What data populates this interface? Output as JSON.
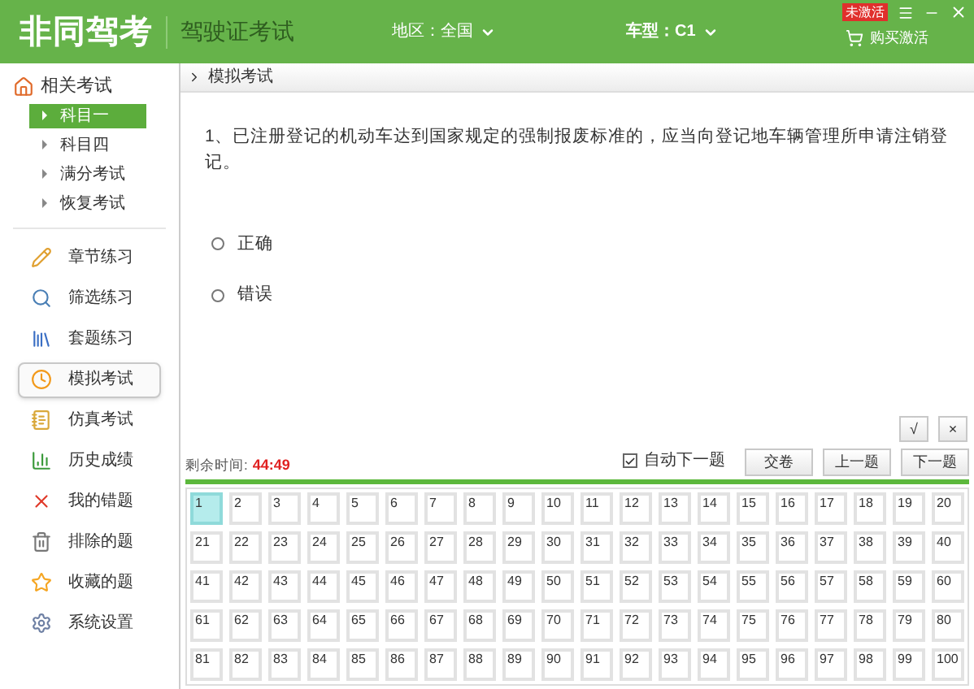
{
  "header": {
    "logo": "非同驾考",
    "subtitle": "驾驶证考试",
    "region": "地区：全国",
    "car_type": "车型：C1",
    "buy": "购买激活",
    "badge": "未激活"
  },
  "sidebar": {
    "section": "相关考试",
    "subjects": [
      {
        "label": "科目一",
        "selected": true
      },
      {
        "label": "科目四",
        "selected": false
      },
      {
        "label": "满分考试",
        "selected": false
      },
      {
        "label": "恢复考试",
        "selected": false
      }
    ],
    "menu": [
      {
        "label": "章节练习",
        "selected": false
      },
      {
        "label": "筛选练习",
        "selected": false
      },
      {
        "label": "套题练习",
        "selected": false
      },
      {
        "label": "模拟考试",
        "selected": true
      },
      {
        "label": "仿真考试",
        "selected": false
      },
      {
        "label": "历史成绩",
        "selected": false
      },
      {
        "label": "我的错题",
        "selected": false
      },
      {
        "label": "排除的题",
        "selected": false
      },
      {
        "label": "收藏的题",
        "selected": false
      },
      {
        "label": "系统设置",
        "selected": false
      }
    ]
  },
  "breadcrumb": "模拟考试",
  "question": "1、已注册登记的机动车达到国家规定的强制报废标准的，应当向登记地车辆管理所申请注销登记。",
  "options": [
    {
      "label": "正确",
      "selected": false
    },
    {
      "label": "错误",
      "selected": false
    }
  ],
  "mark_buttons": [
    "√",
    "×"
  ],
  "timer": {
    "label": "剩余时间:",
    "value": "44:49"
  },
  "auto_next": {
    "label": "自动下一题",
    "checked": true
  },
  "nav_buttons": [
    "交卷",
    "上一题",
    "下一题"
  ],
  "grid": [
    {
      "label": "1",
      "selected": true
    },
    {
      "label": "2",
      "selected": false
    },
    {
      "label": "3",
      "selected": false
    },
    {
      "label": "4",
      "selected": false
    },
    {
      "label": "5",
      "selected": false
    },
    {
      "label": "6",
      "selected": false
    },
    {
      "label": "7",
      "selected": false
    },
    {
      "label": "8",
      "selected": false
    },
    {
      "label": "9",
      "selected": false
    },
    {
      "label": "10",
      "selected": false
    },
    {
      "label": "11",
      "selected": false
    },
    {
      "label": "12",
      "selected": false
    },
    {
      "label": "13",
      "selected": false
    },
    {
      "label": "14",
      "selected": false
    },
    {
      "label": "15",
      "selected": false
    },
    {
      "label": "16",
      "selected": false
    },
    {
      "label": "17",
      "selected": false
    },
    {
      "label": "18",
      "selected": false
    },
    {
      "label": "19",
      "selected": false
    },
    {
      "label": "20",
      "selected": false
    },
    {
      "label": "21",
      "selected": false
    },
    {
      "label": "22",
      "selected": false
    },
    {
      "label": "23",
      "selected": false
    },
    {
      "label": "24",
      "selected": false
    },
    {
      "label": "25",
      "selected": false
    },
    {
      "label": "26",
      "selected": false
    },
    {
      "label": "27",
      "selected": false
    },
    {
      "label": "28",
      "selected": false
    },
    {
      "label": "29",
      "selected": false
    },
    {
      "label": "30",
      "selected": false
    },
    {
      "label": "31",
      "selected": false
    },
    {
      "label": "32",
      "selected": false
    },
    {
      "label": "33",
      "selected": false
    },
    {
      "label": "34",
      "selected": false
    },
    {
      "label": "35",
      "selected": false
    },
    {
      "label": "36",
      "selected": false
    },
    {
      "label": "37",
      "selected": false
    },
    {
      "label": "38",
      "selected": false
    },
    {
      "label": "39",
      "selected": false
    },
    {
      "label": "40",
      "selected": false
    },
    {
      "label": "41",
      "selected": false
    },
    {
      "label": "42",
      "selected": false
    },
    {
      "label": "43",
      "selected": false
    },
    {
      "label": "44",
      "selected": false
    },
    {
      "label": "45",
      "selected": false
    },
    {
      "label": "46",
      "selected": false
    },
    {
      "label": "47",
      "selected": false
    },
    {
      "label": "48",
      "selected": false
    },
    {
      "label": "49",
      "selected": false
    },
    {
      "label": "50",
      "selected": false
    },
    {
      "label": "51",
      "selected": false
    },
    {
      "label": "52",
      "selected": false
    },
    {
      "label": "53",
      "selected": false
    },
    {
      "label": "54",
      "selected": false
    },
    {
      "label": "55",
      "selected": false
    },
    {
      "label": "56",
      "selected": false
    },
    {
      "label": "57",
      "selected": false
    },
    {
      "label": "58",
      "selected": false
    },
    {
      "label": "59",
      "selected": false
    },
    {
      "label": "60",
      "selected": false
    },
    {
      "label": "61",
      "selected": false
    },
    {
      "label": "62",
      "selected": false
    },
    {
      "label": "63",
      "selected": false
    },
    {
      "label": "64",
      "selected": false
    },
    {
      "label": "65",
      "selected": false
    },
    {
      "label": "66",
      "selected": false
    },
    {
      "label": "67",
      "selected": false
    },
    {
      "label": "68",
      "selected": false
    },
    {
      "label": "69",
      "selected": false
    },
    {
      "label": "70",
      "selected": false
    },
    {
      "label": "71",
      "selected": false
    },
    {
      "label": "72",
      "selected": false
    },
    {
      "label": "73",
      "selected": false
    },
    {
      "label": "74",
      "selected": false
    },
    {
      "label": "75",
      "selected": false
    },
    {
      "label": "76",
      "selected": false
    },
    {
      "label": "77",
      "selected": false
    },
    {
      "label": "78",
      "selected": false
    },
    {
      "label": "79",
      "selected": false
    },
    {
      "label": "80",
      "selected": false
    },
    {
      "label": "81",
      "selected": false
    },
    {
      "label": "82",
      "selected": false
    },
    {
      "label": "83",
      "selected": false
    },
    {
      "label": "84",
      "selected": false
    },
    {
      "label": "85",
      "selected": false
    },
    {
      "label": "86",
      "selected": false
    },
    {
      "label": "87",
      "selected": false
    },
    {
      "label": "88",
      "selected": false
    },
    {
      "label": "89",
      "selected": false
    },
    {
      "label": "90",
      "selected": false
    },
    {
      "label": "91",
      "selected": false
    },
    {
      "label": "92",
      "selected": false
    },
    {
      "label": "93",
      "selected": false
    },
    {
      "label": "94",
      "selected": false
    },
    {
      "label": "95",
      "selected": false
    },
    {
      "label": "96",
      "selected": false
    },
    {
      "label": "97",
      "selected": false
    },
    {
      "label": "98",
      "selected": false
    },
    {
      "label": "99",
      "selected": false
    },
    {
      "label": "100",
      "selected": false
    }
  ]
}
